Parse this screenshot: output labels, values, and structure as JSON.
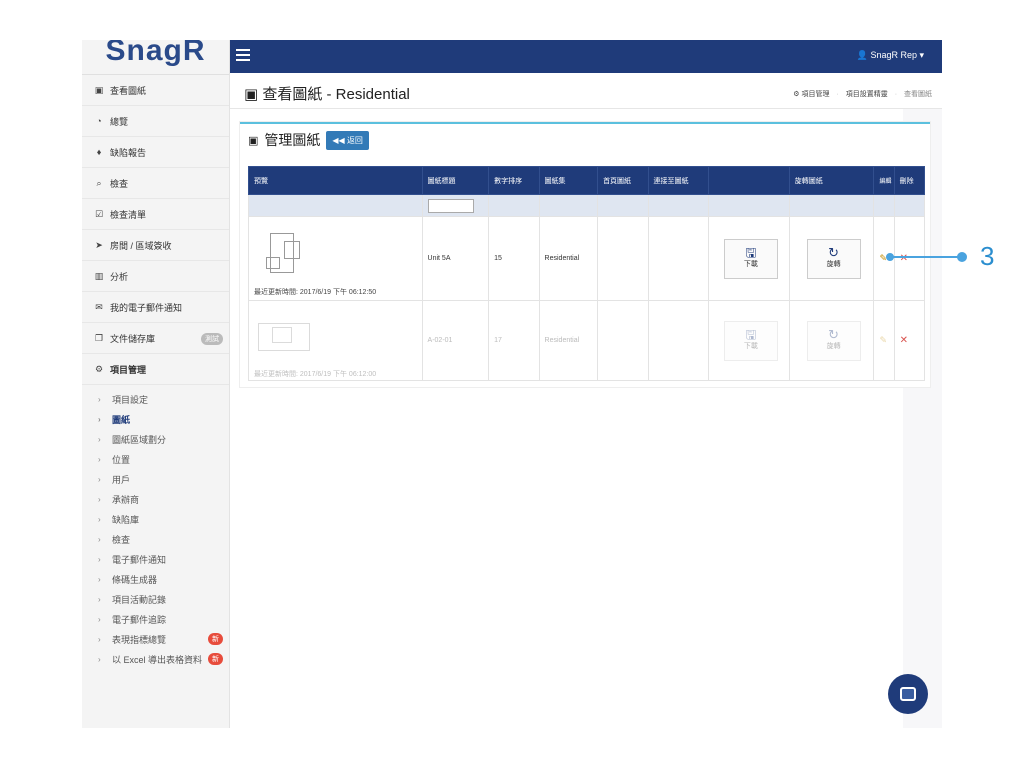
{
  "app": {
    "logo": "SnagR"
  },
  "sidebar": {
    "items": [
      {
        "label": "查看圖紙",
        "icon": "picture-icon"
      },
      {
        "label": "總覽",
        "icon": "dashboard-icon"
      },
      {
        "label": "缺陷報告",
        "icon": "map-marker-icon"
      },
      {
        "label": "檢查",
        "icon": "search-icon"
      },
      {
        "label": "檢查清單",
        "icon": "checkbox-icon"
      },
      {
        "label": "房間 / 區域簽收",
        "icon": "location-arrow-icon"
      },
      {
        "label": "分析",
        "icon": "bar-chart-icon"
      },
      {
        "label": "我的電子郵件通知",
        "icon": "envelope-icon"
      },
      {
        "label": "文件儲存庫",
        "icon": "copy-icon",
        "badge": "測試"
      },
      {
        "label": "項目管理",
        "icon": "cogs-icon"
      }
    ],
    "subitems": [
      {
        "label": "項目設定"
      },
      {
        "label": "圖紙"
      },
      {
        "label": "圖紙區域劃分"
      },
      {
        "label": "位置"
      },
      {
        "label": "用戶"
      },
      {
        "label": "承辦商"
      },
      {
        "label": "缺陷庫"
      },
      {
        "label": "檢查"
      },
      {
        "label": "電子郵件通知"
      },
      {
        "label": "條碼生成器"
      },
      {
        "label": "項目活動記錄"
      },
      {
        "label": "電子郵件追踪"
      },
      {
        "label": "表現指標總覽",
        "badge": "新"
      },
      {
        "label": "以 Excel 導出表格資料",
        "badge": "新"
      }
    ]
  },
  "topbar": {
    "user": "SnagR Rep ▾"
  },
  "header": {
    "title": "查看圖紙 - Residential",
    "breadcrumb": [
      "項目管理",
      "項目設置精靈",
      "查看圖紙"
    ]
  },
  "panel": {
    "title": "管理圖紙",
    "back_label": "返回"
  },
  "table": {
    "columns": [
      "預覽",
      "圖紙標題",
      "數字排序",
      "圖紙集",
      "首頁圖紙",
      "連接至圖紙",
      "",
      "旋轉圖紙",
      "編輯",
      "刪除"
    ],
    "rows": [
      {
        "updated": "最近更新時間: 2017/6/19 下午 06:12:50",
        "title": "Unit 5A",
        "order": "15",
        "set": "Residential",
        "download": "下載",
        "rotate": "旋轉"
      },
      {
        "updated": "最近更新時間: 2017/6/19 下午 06:12:00",
        "title": "A-02-01",
        "order": "17",
        "set": "Residential",
        "download": "下載",
        "rotate": "旋轉"
      }
    ]
  },
  "callout": {
    "number": "3"
  }
}
